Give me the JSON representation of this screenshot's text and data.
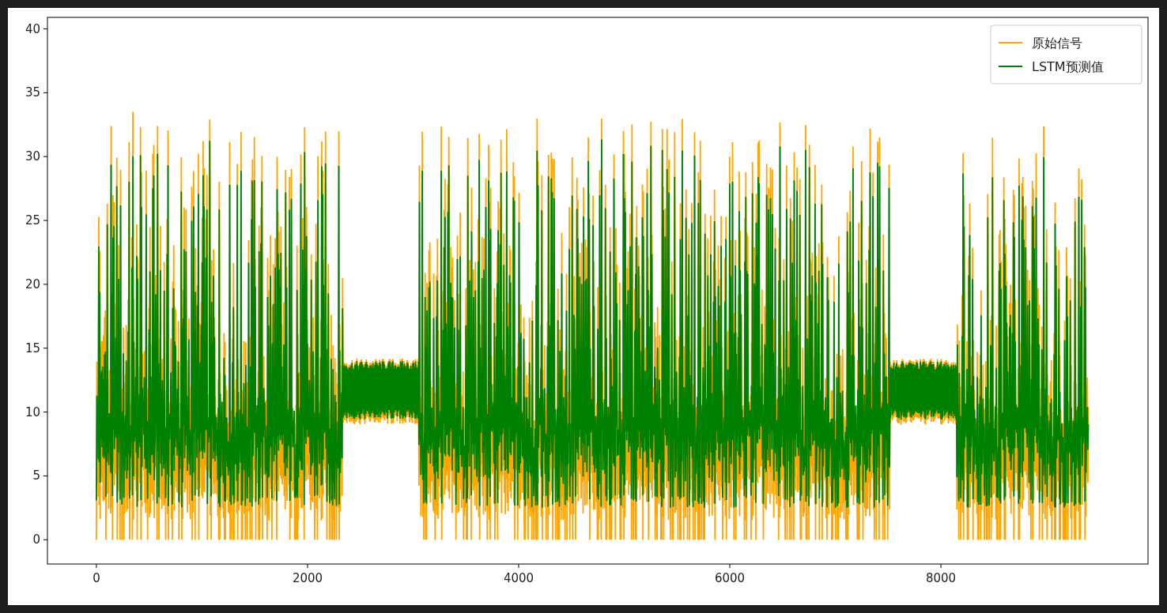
{
  "plot": {
    "y_tick_labels": [
      "40",
      "35",
      "30",
      "25",
      "20",
      "15",
      "10",
      "5",
      "0"
    ],
    "x_tick_labels": [
      "0",
      "2000",
      "4000",
      "6000",
      "8000"
    ],
    "legend": [
      {
        "label": "原始信号",
        "color": "#ffa500"
      },
      {
        "label": "LSTM预测值",
        "color": "#008000"
      }
    ]
  }
}
